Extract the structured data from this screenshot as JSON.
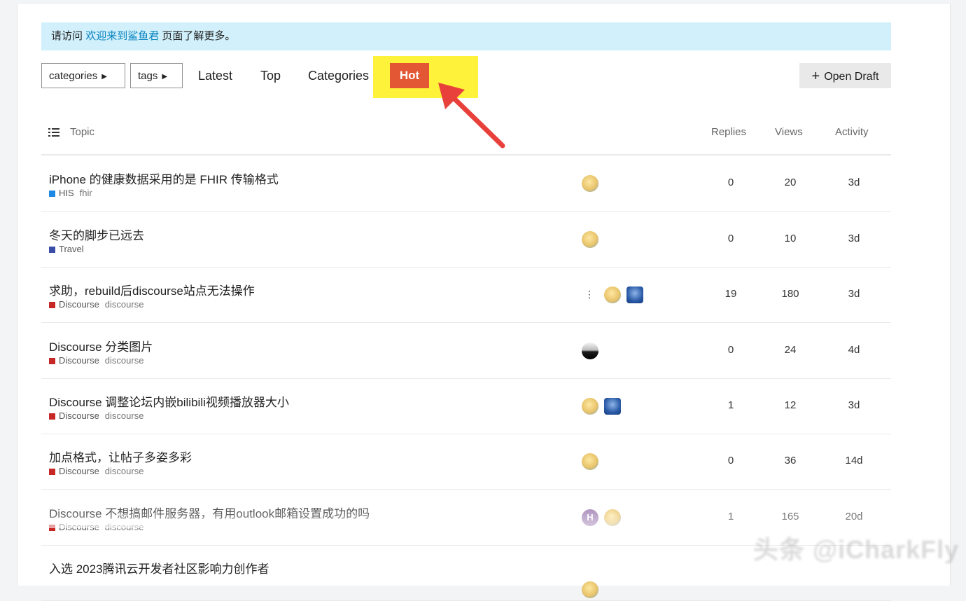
{
  "banner": {
    "prefix": "请访问",
    "link": "欢迎来到鲨鱼君",
    "suffix": "页面了解更多。"
  },
  "nav": {
    "categories_dropdown": "categories",
    "tags_dropdown": "tags",
    "latest": "Latest",
    "top": "Top",
    "categories": "Categories",
    "hot": "Hot",
    "open_draft": "Open Draft"
  },
  "table_header": {
    "topic": "Topic",
    "replies": "Replies",
    "views": "Views",
    "activity": "Activity"
  },
  "topics": [
    {
      "title": "iPhone 的健康数据采用的是 FHIR 传输格式",
      "category": "HIS",
      "category_color": "#1e88e5",
      "tag": "fhir",
      "replies": "0",
      "views": "20",
      "activity": "3d"
    },
    {
      "title": "冬天的脚步已远去",
      "category": "Travel",
      "category_color": "#3a4ea8",
      "tag": "",
      "replies": "0",
      "views": "10",
      "activity": "3d"
    },
    {
      "title": "求助，rebuild后discourse站点无法操作",
      "category": "Discourse",
      "category_color": "#c62828",
      "tag": "discourse",
      "replies": "19",
      "views": "180",
      "activity": "3d"
    },
    {
      "title": "Discourse 分类图片",
      "category": "Discourse",
      "category_color": "#c62828",
      "tag": "discourse",
      "replies": "0",
      "views": "24",
      "activity": "4d"
    },
    {
      "title": "Discourse 调整论坛内嵌bilibili视频播放器大小",
      "category": "Discourse",
      "category_color": "#c62828",
      "tag": "discourse",
      "replies": "1",
      "views": "12",
      "activity": "3d"
    },
    {
      "title": "加点格式，让帖子多姿多彩",
      "category": "Discourse",
      "category_color": "#c62828",
      "tag": "discourse",
      "replies": "0",
      "views": "36",
      "activity": "14d"
    },
    {
      "title": "Discourse 不想搞邮件服务器，有用outlook邮箱设置成功的吗",
      "category": "Discourse",
      "category_color": "#c62828",
      "tag": "discourse",
      "replies": "1",
      "views": "165",
      "activity": "20d"
    },
    {
      "title": "入选 2023腾讯云开发者社区影响力创作者",
      "category": "",
      "category_color": "#c62828",
      "tag": "",
      "replies": "",
      "views": "",
      "activity": ""
    }
  ],
  "avatar_letter": "H",
  "watermark": "头条 @iCharkFly",
  "colors": {
    "hot": "#e45735",
    "highlight": "#fff23b",
    "arrow": "#e8403a",
    "banner": "#d1f0fb"
  }
}
